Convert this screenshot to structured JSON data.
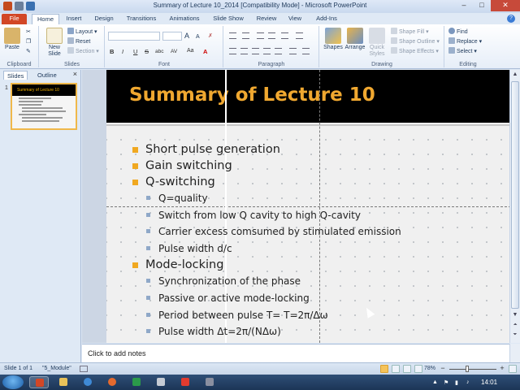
{
  "window": {
    "title": "Summary of Lecture 10_2014 [Compatibility Mode] - Microsoft PowerPoint",
    "minimize": "–",
    "maximize": "□",
    "close": "✕"
  },
  "ribbon": {
    "tabs": [
      "File",
      "Home",
      "Insert",
      "Design",
      "Transitions",
      "Animations",
      "Slide Show",
      "Review",
      "View",
      "Add-Ins"
    ],
    "active_tab": "Home",
    "help_label": "?",
    "clipboard": {
      "paste": "Paste",
      "label": "Clipboard"
    },
    "slides": {
      "new_slide": "New Slide",
      "layout": "Layout",
      "reset": "Reset",
      "section": "Section",
      "label": "Slides"
    },
    "font": {
      "label": "Font",
      "grow": "A",
      "shrink": "A",
      "bold": "B",
      "italic": "I",
      "underline": "U",
      "strike": "S",
      "shadow": "abc",
      "spacing": "AV",
      "case": "Aa",
      "color": "A"
    },
    "paragraph": {
      "label": "Paragraph"
    },
    "drawing": {
      "shapes": "Shapes",
      "arrange": "Arrange",
      "quick_styles": "Quick Styles",
      "shape_fill": "Shape Fill",
      "shape_outline": "Shape Outline",
      "shape_effects": "Shape Effects",
      "label": "Drawing"
    },
    "editing": {
      "find": "Find",
      "replace": "Replace",
      "select": "Select",
      "label": "Editing"
    }
  },
  "left_pane": {
    "tabs": [
      "Slides",
      "Outline"
    ],
    "active_tab": "Slides",
    "close": "×",
    "thumbnail": {
      "number": "1",
      "title": "Summary of Lecture 10"
    }
  },
  "slide": {
    "title": "Summary of Lecture 10",
    "bullets": [
      {
        "level": 1,
        "text": "Short pulse generation"
      },
      {
        "level": 1,
        "text": "Gain switching"
      },
      {
        "level": 1,
        "text": "Q-switching"
      },
      {
        "level": 2,
        "text": "Q=quality"
      },
      {
        "level": 2,
        "text": "Switch from low Q cavity to high Q-cavity"
      },
      {
        "level": 2,
        "text": "Carrier excess comsumed by stimulated emission"
      },
      {
        "level": 2,
        "text": "Pulse width d/c"
      },
      {
        "level": 1,
        "text": "Mode-locking"
      },
      {
        "level": 2,
        "text": "Synchronization of the phase"
      },
      {
        "level": 2,
        "text": "Passive or active mode-locking"
      },
      {
        "level": 2,
        "text": "Period between pulse T= T=2π/Δω"
      },
      {
        "level": 2,
        "text": "Pulse width Δt=2π/(NΔω)"
      }
    ]
  },
  "notes": {
    "placeholder": "Click to add notes"
  },
  "status_bar": {
    "slide_info": "Slide 1 of 1",
    "theme": "\"5_Module\"",
    "zoom": "78%",
    "zoom_out": "−",
    "zoom_in": "+"
  },
  "taskbar": {
    "time": "14:01"
  },
  "colors": {
    "title_accent": "#f0a830",
    "bullet_level1": "#f0a820",
    "file_tab": "#d24726",
    "header_bg": "#000000"
  }
}
